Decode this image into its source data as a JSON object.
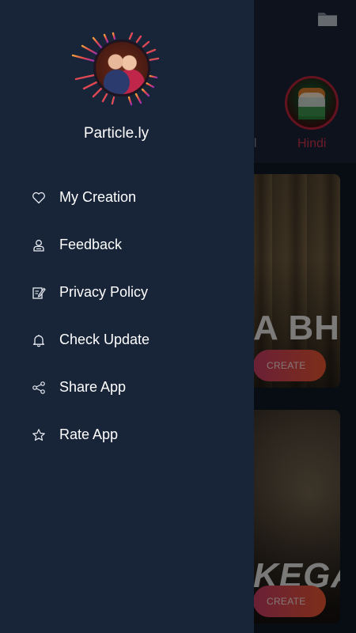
{
  "drawer": {
    "app_name": "Particle.ly",
    "menu": [
      {
        "label": "My Creation",
        "icon": "heart-icon"
      },
      {
        "label": "Feedback",
        "icon": "feedback-person-icon"
      },
      {
        "label": "Privacy Policy",
        "icon": "edit-note-icon"
      },
      {
        "label": "Check Update",
        "icon": "bell-icon"
      },
      {
        "label": "Share App",
        "icon": "share-icon"
      },
      {
        "label": "Rate App",
        "icon": "star-icon"
      }
    ]
  },
  "background": {
    "categories": [
      {
        "label": "al"
      },
      {
        "label": "Hindi"
      }
    ],
    "cards": [
      {
        "title_fragment": "A BH",
        "button": "CREATE"
      },
      {
        "title_fragment": "KEGA",
        "button": "CREATE"
      }
    ]
  },
  "colors": {
    "drawer_bg": "#182438",
    "accent_red": "#c8334a",
    "button_gradient_start": "#c23b63",
    "button_gradient_end": "#e4542f"
  }
}
